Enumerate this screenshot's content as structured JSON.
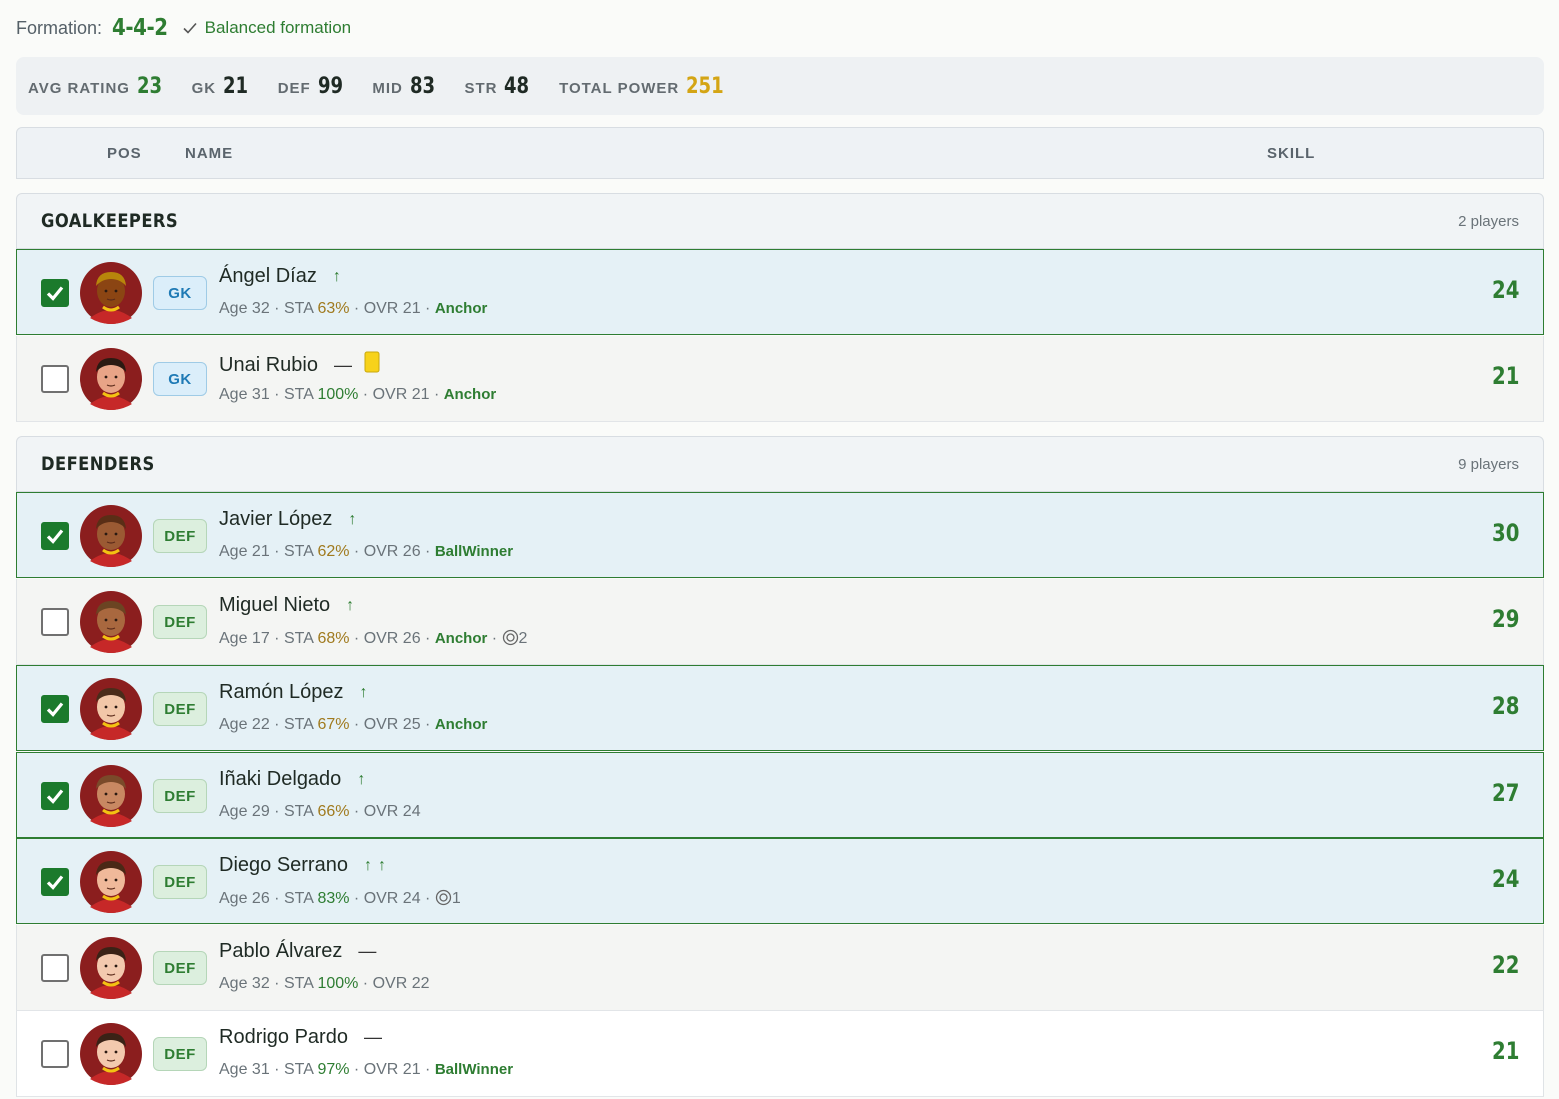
{
  "formation": {
    "label": "Formation:",
    "value": "4-4-2",
    "status": "Balanced formation"
  },
  "stats": [
    {
      "label": "AVG RATING",
      "value": "23",
      "color": "#2e7d32"
    },
    {
      "label": "GK",
      "value": "21",
      "color": "#1f2a24"
    },
    {
      "label": "DEF",
      "value": "99",
      "color": "#1f2a24"
    },
    {
      "label": "MID",
      "value": "83",
      "color": "#1f2a24"
    },
    {
      "label": "STR",
      "value": "48",
      "color": "#1f2a24"
    },
    {
      "label": "TOTAL POWER",
      "value": "251",
      "color": "#d4a514"
    }
  ],
  "table_header": {
    "pos": "POS",
    "name": "NAME",
    "skill": "SKILL"
  },
  "groups": {
    "goalkeepers": {
      "title": "GOALKEEPERS",
      "count": "2 players"
    },
    "defenders": {
      "title": "DEFENDERS",
      "count": "9 players"
    }
  },
  "players": [
    {
      "name": "Ángel Díaz",
      "pos": "GK",
      "checked": true,
      "trend": "↑",
      "card": false,
      "age": "Age 32",
      "sta_label": "STA",
      "sta": "63%",
      "sta_level": "mid",
      "ovr": "OVR 21",
      "trait": "Anchor",
      "extra": "",
      "skill": "24",
      "skin": "#8b4513",
      "hair": "#b8860b"
    },
    {
      "name": "Unai Rubio",
      "pos": "GK",
      "checked": false,
      "trend": "—",
      "card": true,
      "age": "Age 31",
      "sta_label": "STA",
      "sta": "100%",
      "sta_level": "high",
      "ovr": "OVR 21",
      "trait": "Anchor",
      "extra": "",
      "skill": "21",
      "skin": "#e8a487",
      "hair": "#2b1a12"
    },
    {
      "name": "Javier López",
      "pos": "DEF",
      "checked": true,
      "trend": "↑",
      "card": false,
      "age": "Age 21",
      "sta_label": "STA",
      "sta": "62%",
      "sta_level": "mid",
      "ovr": "OVR 26",
      "trait": "BallWinner",
      "extra": "",
      "skill": "30",
      "skin": "#9b5a33",
      "hair": "#5a2e16"
    },
    {
      "name": "Miguel Nieto",
      "pos": "DEF",
      "checked": false,
      "trend": "↑",
      "card": false,
      "age": "Age 17",
      "sta_label": "STA",
      "sta": "68%",
      "sta_level": "mid",
      "ovr": "OVR 26",
      "trait": "Anchor",
      "extra": "2",
      "skill": "29",
      "skin": "#a9683f",
      "hair": "#6b4422"
    },
    {
      "name": "Ramón López",
      "pos": "DEF",
      "checked": true,
      "trend": "↑",
      "card": false,
      "age": "Age 22",
      "sta_label": "STA",
      "sta": "67%",
      "sta_level": "mid",
      "ovr": "OVR 25",
      "trait": "Anchor",
      "extra": "",
      "skill": "28",
      "skin": "#f2c7a8",
      "hair": "#4a2c1a"
    },
    {
      "name": "Iñaki Delgado",
      "pos": "DEF",
      "checked": true,
      "trend": "↑",
      "card": false,
      "age": "Age 29",
      "sta_label": "STA",
      "sta": "66%",
      "sta_level": "mid",
      "ovr": "OVR 24",
      "trait": "",
      "extra": "",
      "skill": "27",
      "skin": "#c88862",
      "hair": "#7a4a2a"
    },
    {
      "name": "Diego Serrano",
      "pos": "DEF",
      "checked": true,
      "trend": "↑↑",
      "card": false,
      "age": "Age 26",
      "sta_label": "STA",
      "sta": "83%",
      "sta_level": "high",
      "ovr": "OVR 24",
      "trait": "",
      "extra": "1",
      "skill": "24",
      "skin": "#f0b99a",
      "hair": "#4a2816"
    },
    {
      "name": "Pablo Álvarez",
      "pos": "DEF",
      "checked": false,
      "trend": "—",
      "card": false,
      "age": "Age 32",
      "sta_label": "STA",
      "sta": "100%",
      "sta_level": "high",
      "ovr": "OVR 22",
      "trait": "",
      "extra": "",
      "skill": "22",
      "skin": "#f3c9ae",
      "hair": "#3a2216"
    },
    {
      "name": "Rodrigo Pardo",
      "pos": "DEF",
      "checked": false,
      "trend": "—",
      "card": false,
      "age": "Age 31",
      "sta_label": "STA",
      "sta": "97%",
      "sta_level": "high",
      "ovr": "OVR 21",
      "trait": "BallWinner",
      "extra": "",
      "skill": "21",
      "skin": "#f3c9ae",
      "hair": "#3a2216"
    }
  ]
}
